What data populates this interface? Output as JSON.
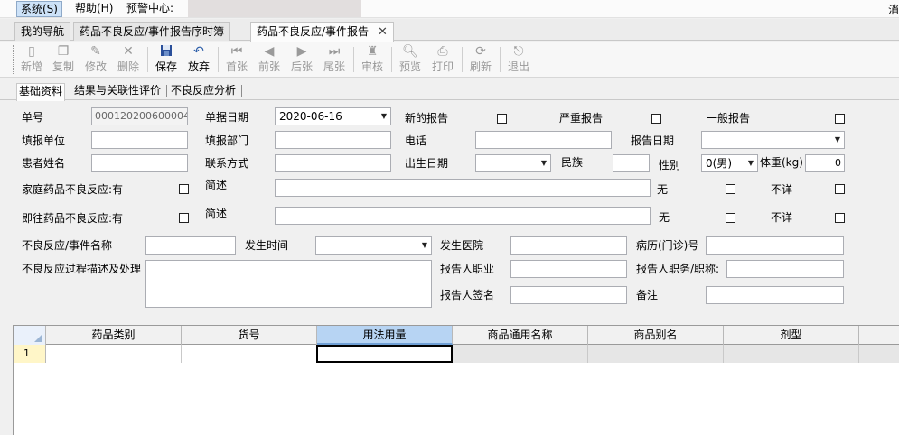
{
  "menu": {
    "system": "系统(S)",
    "help": "帮助(H)",
    "alert_center": "预警中心:",
    "right_char": "消"
  },
  "doc_tabs": [
    {
      "label": "我的导航"
    },
    {
      "label": "药品不良反应/事件报告序时簿"
    },
    {
      "label": "药品不良反应/事件报告",
      "close": "✕"
    }
  ],
  "toolbar": {
    "new": "新增",
    "copy": "复制",
    "modify": "修改",
    "delete": "删除",
    "save": "保存",
    "discard": "放弃",
    "first": "首张",
    "prev": "前张",
    "next": "后张",
    "last": "尾张",
    "audit": "审核",
    "preview": "预览",
    "print": "打印",
    "refresh": "刷新",
    "exit": "退出"
  },
  "inner_tabs": [
    "基础资料",
    "结果与关联性评价",
    "不良反应分析"
  ],
  "form": {
    "doc_no_label": "单号",
    "doc_no_value": "000120200600004",
    "doc_date_label": "单据日期",
    "doc_date_value": "2020-06-16",
    "new_report": "新的报告",
    "serious_report": "严重报告",
    "general_report": "一般报告",
    "reporting_unit": "填报单位",
    "reporting_dept": "填报部门",
    "phone": "电话",
    "report_date": "报告日期",
    "patient_name": "患者姓名",
    "contact": "联系方式",
    "birth_date": "出生日期",
    "ethnicity": "民族",
    "gender": "性别",
    "gender_value": "0(男)",
    "weight": "体重(kg)",
    "weight_value": "0",
    "family_adr": "家庭药品不良反应:有",
    "brief1": "简述",
    "none1": "无",
    "unknown1": "不详",
    "past_adr": "即往药品不良反应:有",
    "brief2": "简述",
    "none2": "无",
    "unknown2": "不详",
    "event_name": "不良反应/事件名称",
    "occur_time": "发生时间",
    "hospital": "发生医院",
    "record_no": "病历(门诊)号",
    "process_desc": "不良反应过程描述及处理",
    "reporter_job": "报告人职业",
    "reporter_title": "报告人职务/职称:",
    "reporter_sign": "报告人签名",
    "remark": "备注"
  },
  "grid": {
    "columns": [
      "药品类别",
      "货号",
      "用法用量",
      "商品通用名称",
      "商品别名",
      "剂型"
    ],
    "row_number": "1"
  }
}
